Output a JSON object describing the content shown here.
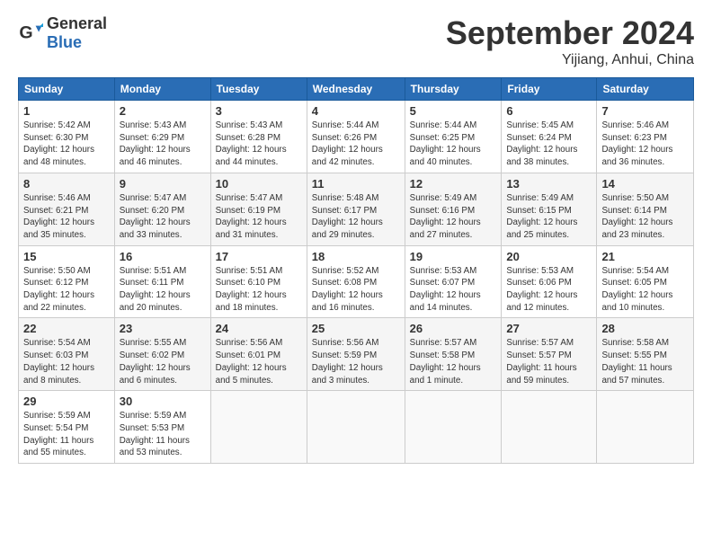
{
  "header": {
    "logo_general": "General",
    "logo_blue": "Blue",
    "month_year": "September 2024",
    "location": "Yijiang, Anhui, China"
  },
  "weekdays": [
    "Sunday",
    "Monday",
    "Tuesday",
    "Wednesday",
    "Thursday",
    "Friday",
    "Saturday"
  ],
  "weeks": [
    [
      {
        "day": "1",
        "info": "Sunrise: 5:42 AM\nSunset: 6:30 PM\nDaylight: 12 hours\nand 48 minutes."
      },
      {
        "day": "2",
        "info": "Sunrise: 5:43 AM\nSunset: 6:29 PM\nDaylight: 12 hours\nand 46 minutes."
      },
      {
        "day": "3",
        "info": "Sunrise: 5:43 AM\nSunset: 6:28 PM\nDaylight: 12 hours\nand 44 minutes."
      },
      {
        "day": "4",
        "info": "Sunrise: 5:44 AM\nSunset: 6:26 PM\nDaylight: 12 hours\nand 42 minutes."
      },
      {
        "day": "5",
        "info": "Sunrise: 5:44 AM\nSunset: 6:25 PM\nDaylight: 12 hours\nand 40 minutes."
      },
      {
        "day": "6",
        "info": "Sunrise: 5:45 AM\nSunset: 6:24 PM\nDaylight: 12 hours\nand 38 minutes."
      },
      {
        "day": "7",
        "info": "Sunrise: 5:46 AM\nSunset: 6:23 PM\nDaylight: 12 hours\nand 36 minutes."
      }
    ],
    [
      {
        "day": "8",
        "info": "Sunrise: 5:46 AM\nSunset: 6:21 PM\nDaylight: 12 hours\nand 35 minutes."
      },
      {
        "day": "9",
        "info": "Sunrise: 5:47 AM\nSunset: 6:20 PM\nDaylight: 12 hours\nand 33 minutes."
      },
      {
        "day": "10",
        "info": "Sunrise: 5:47 AM\nSunset: 6:19 PM\nDaylight: 12 hours\nand 31 minutes."
      },
      {
        "day": "11",
        "info": "Sunrise: 5:48 AM\nSunset: 6:17 PM\nDaylight: 12 hours\nand 29 minutes."
      },
      {
        "day": "12",
        "info": "Sunrise: 5:49 AM\nSunset: 6:16 PM\nDaylight: 12 hours\nand 27 minutes."
      },
      {
        "day": "13",
        "info": "Sunrise: 5:49 AM\nSunset: 6:15 PM\nDaylight: 12 hours\nand 25 minutes."
      },
      {
        "day": "14",
        "info": "Sunrise: 5:50 AM\nSunset: 6:14 PM\nDaylight: 12 hours\nand 23 minutes."
      }
    ],
    [
      {
        "day": "15",
        "info": "Sunrise: 5:50 AM\nSunset: 6:12 PM\nDaylight: 12 hours\nand 22 minutes."
      },
      {
        "day": "16",
        "info": "Sunrise: 5:51 AM\nSunset: 6:11 PM\nDaylight: 12 hours\nand 20 minutes."
      },
      {
        "day": "17",
        "info": "Sunrise: 5:51 AM\nSunset: 6:10 PM\nDaylight: 12 hours\nand 18 minutes."
      },
      {
        "day": "18",
        "info": "Sunrise: 5:52 AM\nSunset: 6:08 PM\nDaylight: 12 hours\nand 16 minutes."
      },
      {
        "day": "19",
        "info": "Sunrise: 5:53 AM\nSunset: 6:07 PM\nDaylight: 12 hours\nand 14 minutes."
      },
      {
        "day": "20",
        "info": "Sunrise: 5:53 AM\nSunset: 6:06 PM\nDaylight: 12 hours\nand 12 minutes."
      },
      {
        "day": "21",
        "info": "Sunrise: 5:54 AM\nSunset: 6:05 PM\nDaylight: 12 hours\nand 10 minutes."
      }
    ],
    [
      {
        "day": "22",
        "info": "Sunrise: 5:54 AM\nSunset: 6:03 PM\nDaylight: 12 hours\nand 8 minutes."
      },
      {
        "day": "23",
        "info": "Sunrise: 5:55 AM\nSunset: 6:02 PM\nDaylight: 12 hours\nand 6 minutes."
      },
      {
        "day": "24",
        "info": "Sunrise: 5:56 AM\nSunset: 6:01 PM\nDaylight: 12 hours\nand 5 minutes."
      },
      {
        "day": "25",
        "info": "Sunrise: 5:56 AM\nSunset: 5:59 PM\nDaylight: 12 hours\nand 3 minutes."
      },
      {
        "day": "26",
        "info": "Sunrise: 5:57 AM\nSunset: 5:58 PM\nDaylight: 12 hours\nand 1 minute."
      },
      {
        "day": "27",
        "info": "Sunrise: 5:57 AM\nSunset: 5:57 PM\nDaylight: 11 hours\nand 59 minutes."
      },
      {
        "day": "28",
        "info": "Sunrise: 5:58 AM\nSunset: 5:55 PM\nDaylight: 11 hours\nand 57 minutes."
      }
    ],
    [
      {
        "day": "29",
        "info": "Sunrise: 5:59 AM\nSunset: 5:54 PM\nDaylight: 11 hours\nand 55 minutes."
      },
      {
        "day": "30",
        "info": "Sunrise: 5:59 AM\nSunset: 5:53 PM\nDaylight: 11 hours\nand 53 minutes."
      },
      {
        "day": "",
        "info": ""
      },
      {
        "day": "",
        "info": ""
      },
      {
        "day": "",
        "info": ""
      },
      {
        "day": "",
        "info": ""
      },
      {
        "day": "",
        "info": ""
      }
    ]
  ]
}
